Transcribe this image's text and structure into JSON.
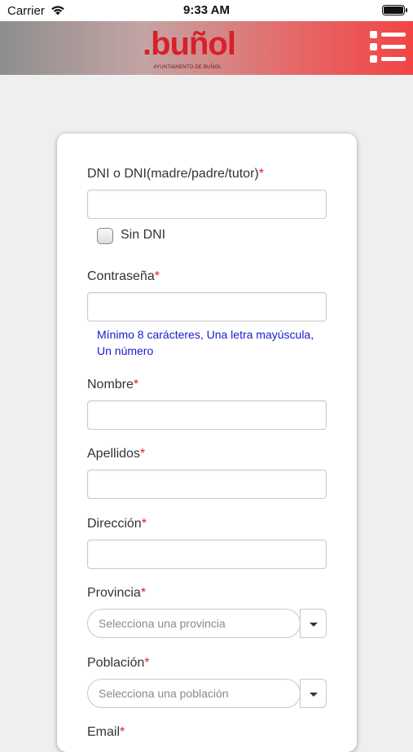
{
  "status_bar": {
    "carrier": "Carrier",
    "time": "9:33 AM"
  },
  "header": {
    "logo_text": ".buñol",
    "logo_subtitle": "AYUNTAMIENTO DE BUÑOL",
    "menu_icon": "menu-icon",
    "gradient_colors": [
      "#8e8e8e",
      "#f24444"
    ]
  },
  "form": {
    "required_marker": "*",
    "dni": {
      "label": "DNI o DNI(madre/padre/tutor)",
      "value": ""
    },
    "sin_dni": {
      "label": "Sin DNI",
      "checked": false
    },
    "password": {
      "label": "Contraseña",
      "value": "",
      "hint": "Mínimo 8 carácteres, Una letra mayúscula, Un número"
    },
    "nombre": {
      "label": "Nombre",
      "value": ""
    },
    "apellidos": {
      "label": "Apellidos",
      "value": ""
    },
    "direccion": {
      "label": "Dirección",
      "value": ""
    },
    "provincia": {
      "label": "Provincia",
      "placeholder": "Selecciona una provincia"
    },
    "poblacion": {
      "label": "Población",
      "placeholder": "Selecciona una población"
    },
    "email": {
      "label": "Email"
    }
  },
  "colors": {
    "required": "#dd2222",
    "hint": "#1a1ad0",
    "brand": "#d8202a"
  }
}
